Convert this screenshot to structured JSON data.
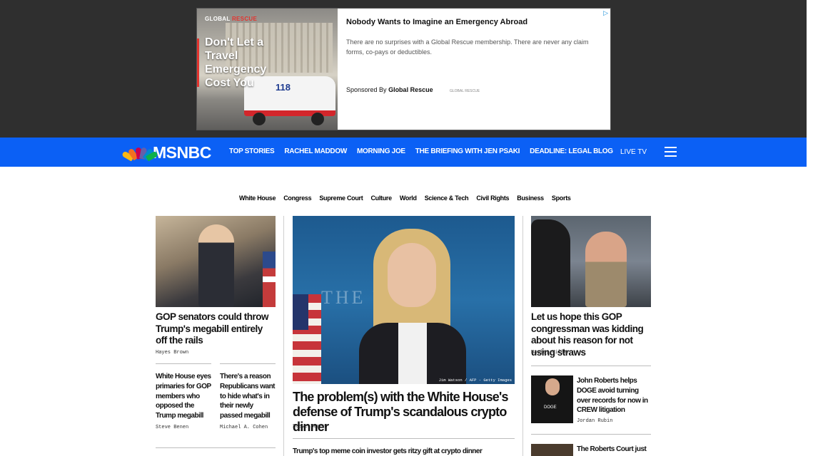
{
  "ad": {
    "logo_part1": "GLOBAL",
    "logo_part2": "RESCUE",
    "image_headline": "Don't Let a Travel Emergency Cost You",
    "ambulance_number": "118",
    "title": "Nobody Wants to Imagine an Emergency Abroad",
    "text": "There are no surprises with a Global Rescue membership. There are never any claim forms, co-pays or deductibles.",
    "sponsored_prefix": "Sponsored By",
    "sponsor_name": "Global Rescue",
    "mini_logo": "GLOBAL RESCUE",
    "adchoices_icon": "▷"
  },
  "header": {
    "logo_text": "MSNBC",
    "nav": [
      "TOP STORIES",
      "RACHEL MADDOW",
      "MORNING JOE",
      "THE BRIEFING WITH JEN PSAKI",
      "DEADLINE: LEGAL BLOG"
    ],
    "live_tv": "LIVE TV",
    "brand_color": "#0b60f5"
  },
  "sections": [
    "White House",
    "Congress",
    "Supreme Court",
    "Culture",
    "World",
    "Science & Tech",
    "Civil Rights",
    "Business",
    "Sports"
  ],
  "left": {
    "main": {
      "title": "GOP senators could throw Trump's megabill entirely off the rails",
      "byline": "Hayes Brown"
    },
    "sub1": {
      "title": "White House eyes primaries for GOP members who opposed the Trump megabill",
      "byline": "Steve Benen"
    },
    "sub2": {
      "title": "There's a reason Republicans want to hide what's in their newly passed megabill",
      "byline": "Michael A. Cohen"
    }
  },
  "center": {
    "photo_credit": "Jim Watson / AFP - Getty Images",
    "photo_sign": "THE WH",
    "title": "The problem(s) with the White House's defense of Trump's scandalous crypto dinner",
    "byline": "Steve Benen",
    "next_title": "Trump's top meme coin investor gets ritzy gift at crypto dinner"
  },
  "right": {
    "main": {
      "title": "Let us hope this GOP congressman was kidding about his reason for not using straws",
      "byline": "Hayley Miller"
    },
    "item1": {
      "title": "John Roberts helps DOGE avoid turning over records for now in CREW litigation",
      "byline": "Jordan Rubin",
      "shirt_text": "DOGE"
    },
    "item2": {
      "title": "The Roberts Court just"
    }
  }
}
